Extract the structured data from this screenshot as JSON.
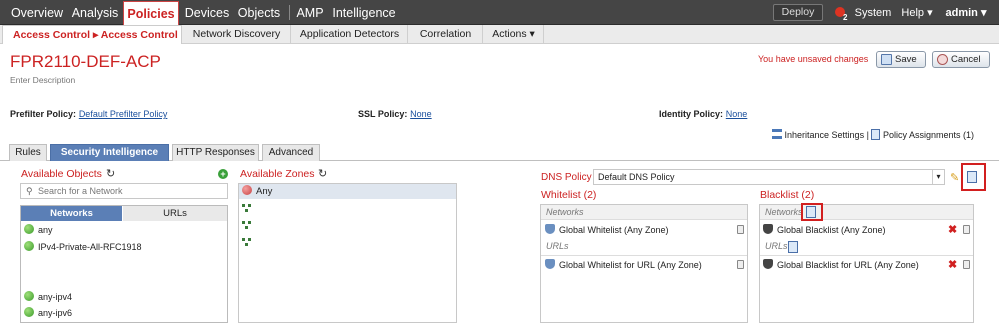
{
  "topnav": {
    "items": [
      "Overview",
      "Analysis",
      "Policies",
      "Devices",
      "Objects",
      "AMP",
      "Intelligence"
    ],
    "deploy": "Deploy",
    "alert_count": "2",
    "system": "System",
    "help": "Help ▾",
    "user": "admin ▾"
  },
  "subnav": {
    "items": [
      "Access Control ▸ Access Control",
      "Network Discovery",
      "Application Detectors",
      "Correlation",
      "Actions ▾"
    ]
  },
  "policy": {
    "name": "FPR2110-DEF-ACP",
    "description_placeholder": "Enter Description",
    "unsaved": "You have unsaved changes",
    "save": "Save",
    "cancel": "Cancel"
  },
  "policy_links": {
    "prefilter_label": "Prefilter Policy:",
    "prefilter_value": "Default Prefilter Policy",
    "ssl_label": "SSL Policy:",
    "ssl_value": "None",
    "identity_label": "Identity Policy:",
    "identity_value": "None",
    "inheritance": "Inheritance Settings",
    "sep": "|",
    "assignments": "Policy Assignments (1)"
  },
  "tabs": [
    "Rules",
    "Security Intelligence",
    "HTTP Responses",
    "Advanced"
  ],
  "available_objects": {
    "title": "Available Objects",
    "search_placeholder": "Search for a Network",
    "subtabs": [
      "Networks",
      "URLs"
    ],
    "items_top": [
      "any",
      "IPv4-Private-All-RFC1918"
    ],
    "items_bottom": [
      "any-ipv4",
      "any-ipv6"
    ]
  },
  "available_zones": {
    "title": "Available Zones",
    "items": [
      "Any"
    ]
  },
  "dns": {
    "label": "DNS Policy",
    "value": "Default DNS Policy"
  },
  "whitelist": {
    "title": "Whitelist (2)",
    "networks_header": "Networks",
    "network_item": "Global Whitelist (Any Zone)",
    "urls_header": "URLs",
    "url_item": "Global Whitelist for URL (Any Zone)"
  },
  "blacklist": {
    "title": "Blacklist (2)",
    "networks_header": "Networks",
    "network_item": "Global Blacklist (Any Zone)",
    "urls_header": "URLs",
    "url_item": "Global Blacklist for URL (Any Zone)"
  },
  "colors": {
    "accent_red": "#cc2222",
    "nav_bg": "#454545",
    "active_tab": "#5b7fb6",
    "link": "#1a4f9c",
    "highlight_box": "#d21f1f"
  },
  "icons": [
    "refresh-icon",
    "add-icon",
    "search-icon",
    "network-object-icon",
    "zone-icon",
    "edit-icon",
    "document-icon",
    "trash-icon",
    "delete-icon",
    "whitelist-shield-icon",
    "blacklist-shield-icon"
  ]
}
